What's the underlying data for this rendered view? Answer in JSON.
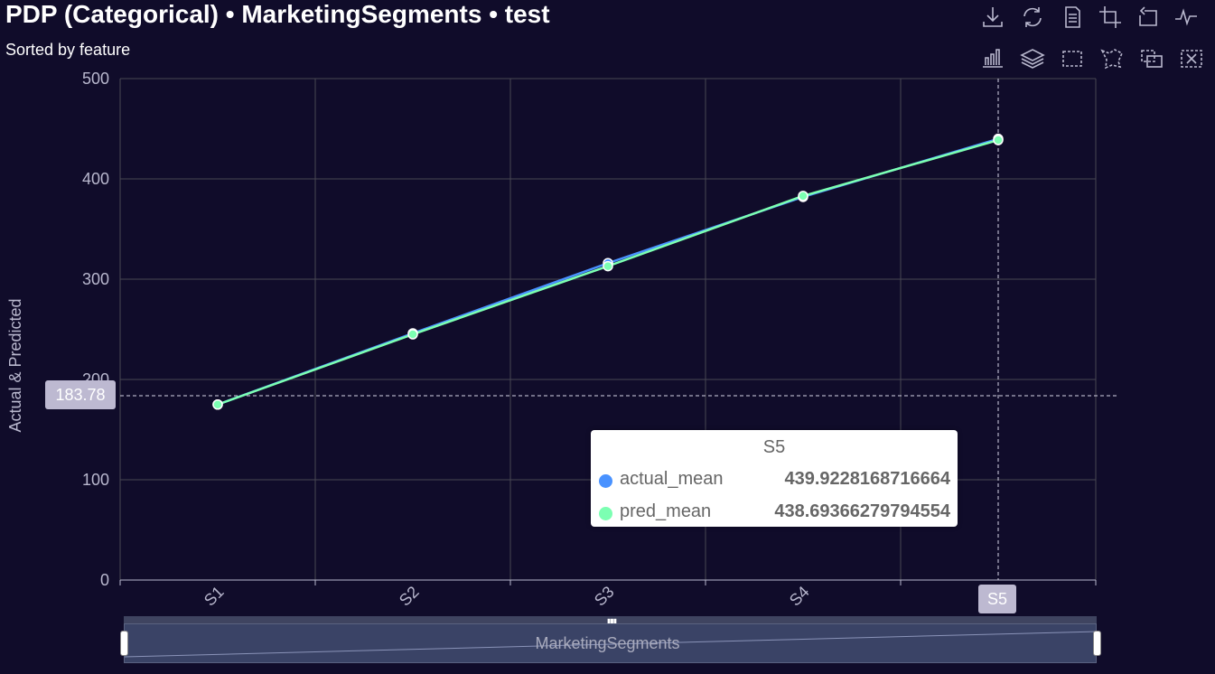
{
  "header": {
    "title": "PDP (Categorical) • MarketingSegments • test",
    "subtitle": "Sorted by feature"
  },
  "toolbox": [
    {
      "name": "download-icon"
    },
    {
      "name": "refresh-icon"
    },
    {
      "name": "data-view-icon"
    },
    {
      "name": "zoom-select-icon"
    },
    {
      "name": "zoom-reset-icon"
    },
    {
      "name": "line-chart-icon"
    },
    {
      "name": "bar-chart-icon"
    },
    {
      "name": "stack-icon"
    },
    {
      "name": "rect-select-icon"
    },
    {
      "name": "lasso-select-icon"
    },
    {
      "name": "keep-select-icon"
    },
    {
      "name": "clear-select-icon"
    }
  ],
  "colors": {
    "background": "#100c2a",
    "actual": "#4992ff",
    "pred": "#7cffb2",
    "grid": "#484753",
    "axis_text": "#b9b8ce"
  },
  "chart_data": {
    "type": "line",
    "categories": [
      "S1",
      "S2",
      "S3",
      "S4",
      "S5"
    ],
    "series": [
      {
        "name": "actual_mean",
        "values": [
          175,
          246,
          316,
          382,
          439.9228168716664
        ]
      },
      {
        "name": "pred_mean",
        "values": [
          175,
          245,
          313,
          383,
          438.69366279794554
        ]
      }
    ],
    "ylabel": "Actual & Predicted",
    "ylim": [
      0,
      500
    ],
    "yticks": [
      0,
      100,
      200,
      300,
      400,
      500
    ],
    "grid": true,
    "pointer": {
      "y_value": "183.78",
      "x_category": "S5"
    },
    "tooltip": {
      "title": "S5",
      "rows": [
        {
          "name": "actual_mean",
          "value": "439.9228168716664"
        },
        {
          "name": "pred_mean",
          "value": "438.69366279794554"
        }
      ]
    },
    "zoom_label": "MarketingSegments"
  }
}
